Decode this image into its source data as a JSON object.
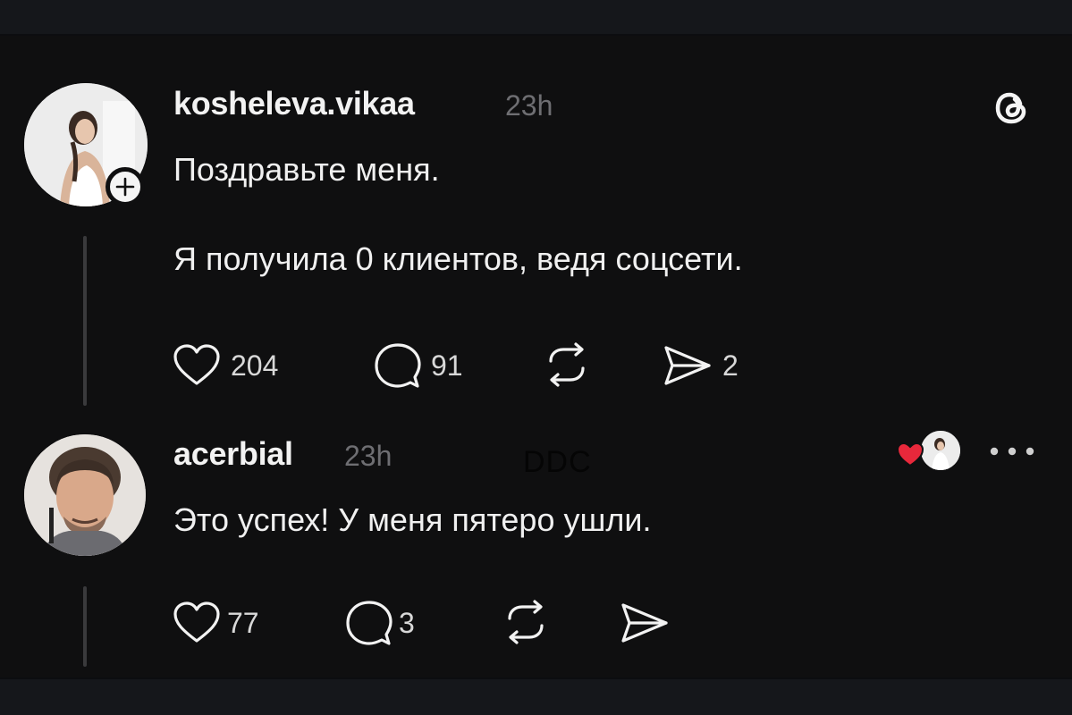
{
  "post": {
    "username": "kosheleva.vikaa",
    "time": "23h",
    "line1": "Поздравьте меня.",
    "line2": "Я получила 0 клиентов, ведя соцсети.",
    "likes": "204",
    "replies": "91",
    "shares": "2"
  },
  "reply": {
    "username": "acerbial",
    "time": "23h",
    "text": "Это успех! У меня пятеро ушли.",
    "likes": "77",
    "replies": "3"
  },
  "watermark": "DDC",
  "icons": {
    "app": "threads-logo-icon",
    "follow": "plus-icon",
    "like": "heart-icon",
    "reply": "comment-icon",
    "repost": "repost-icon",
    "share": "send-icon",
    "menu": "more-horizontal-icon",
    "author_liked": "red-heart-icon"
  },
  "colors": {
    "background": "#0f0f10",
    "text": "#f0f0f0",
    "muted": "#6e6e72",
    "heart_red": "#e8283b"
  }
}
